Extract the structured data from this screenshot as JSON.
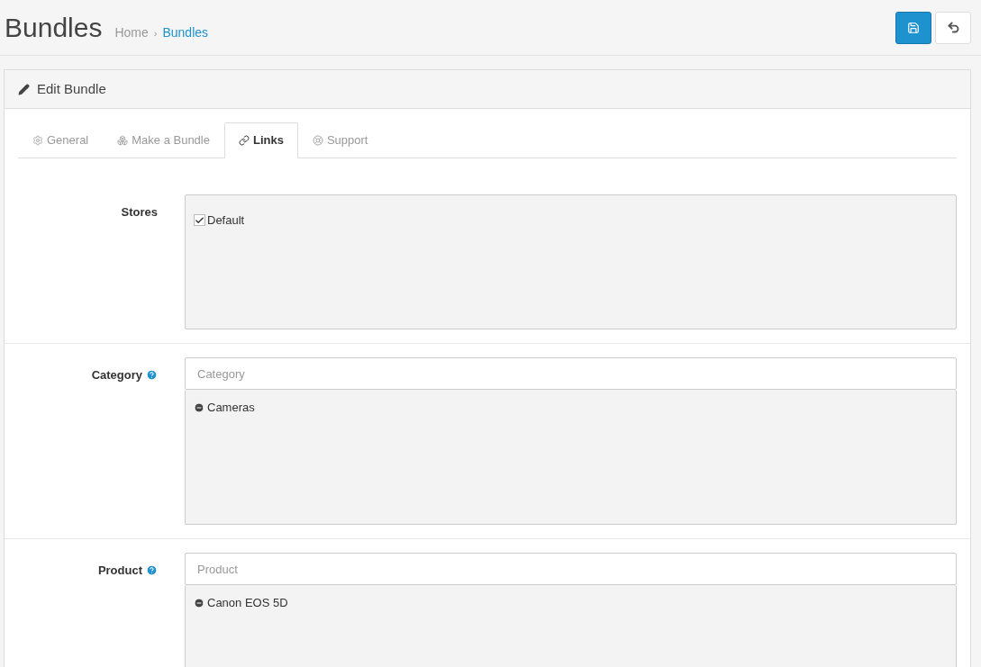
{
  "header": {
    "title": "Bundles",
    "separator": "›",
    "breadcrumb": [
      {
        "label": "Home",
        "current": false
      },
      {
        "label": "Bundles",
        "current": true
      }
    ]
  },
  "panel": {
    "title": "Edit Bundle"
  },
  "tabs": [
    {
      "label": "General",
      "selected": false
    },
    {
      "label": "Make a Bundle",
      "selected": false
    },
    {
      "label": "Links",
      "selected": true
    },
    {
      "label": "Support",
      "selected": false
    }
  ],
  "fields": [
    {
      "kind": "checkbox_list",
      "label": "Stores",
      "help": false,
      "items": [
        {
          "label": "Default",
          "checked": true
        }
      ]
    },
    {
      "kind": "autocomplete",
      "label": "Category",
      "help": true,
      "placeholder": "Category",
      "items": [
        {
          "label": "Cameras"
        }
      ]
    },
    {
      "kind": "autocomplete",
      "label": "Product",
      "help": true,
      "placeholder": "Product",
      "items": [
        {
          "label": "Canon EOS 5D"
        }
      ]
    }
  ]
}
